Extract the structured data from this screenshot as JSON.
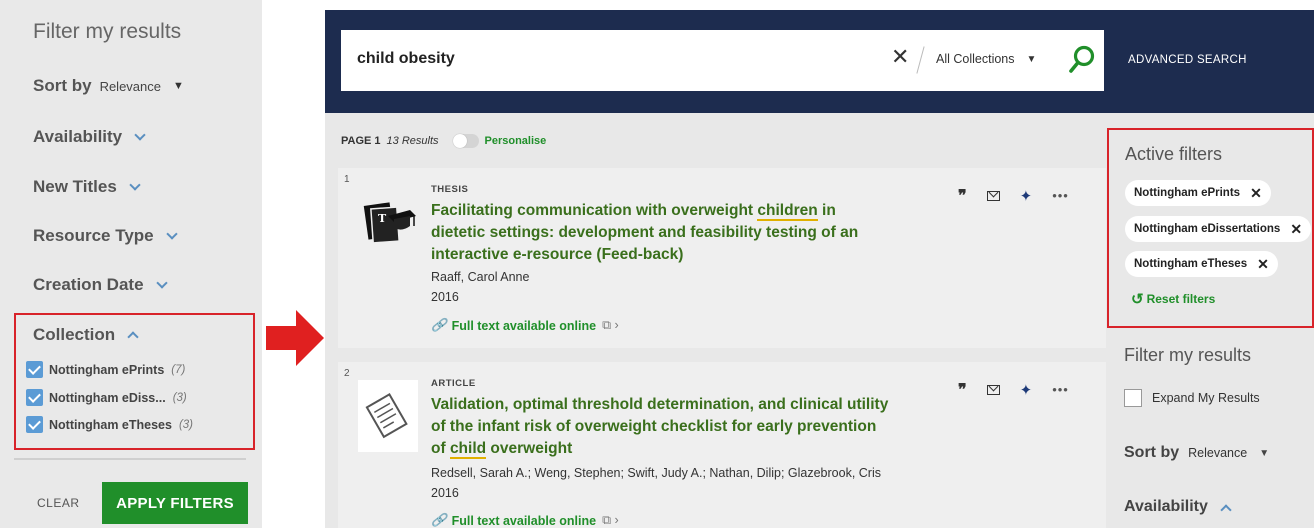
{
  "left_panel": {
    "title": "Filter my results",
    "sort_label": "Sort by",
    "sort_value": "Relevance",
    "sections": [
      "Availability",
      "New Titles",
      "Resource Type",
      "Creation Date"
    ],
    "collection": {
      "label": "Collection",
      "items": [
        {
          "label": "Nottingham ePrints",
          "count": "(7)"
        },
        {
          "label": "Nottingham eDiss...",
          "count": "(3)"
        },
        {
          "label": "Nottingham eTheses",
          "count": "(3)"
        }
      ]
    },
    "clear_label": "CLEAR",
    "apply_label": "APPLY FILTERS"
  },
  "search": {
    "query": "child obesity",
    "scope": "All Collections",
    "advanced_label": "ADVANCED SEARCH"
  },
  "results_bar": {
    "page": "PAGE 1",
    "count": "13 Results",
    "personalise": "Personalise"
  },
  "results": [
    {
      "number": "1",
      "type": "THESIS",
      "title_before": "Facilitating communication with overweight ",
      "title_highlight": "children",
      "title_after": " in dietetic settings: development and feasibility testing of an interactive e-resource (Feed-back)",
      "author": "Raaff, Carol Anne",
      "year": "2016",
      "link": "Full text available online"
    },
    {
      "number": "2",
      "type": "ARTICLE",
      "title_before": "Validation, optimal threshold determination, and clinical utility of the infant risk of overweight checklist for early prevention of ",
      "title_highlight": "child",
      "title_after": " overweight",
      "author": "Redsell, Sarah A.; Weng, Stephen; Swift, Judy A.; Nathan, Dilip; Glazebrook, Cris",
      "year": "2016",
      "link": "Full text available online"
    }
  ],
  "active_filters": {
    "title": "Active filters",
    "chips": [
      "Nottingham ePrints",
      "Nottingham eDissertations",
      "Nottingham eTheses"
    ],
    "reset_label": "Reset filters"
  },
  "right_filters": {
    "title": "Filter my results",
    "expand_label": "Expand My Results",
    "sort_label": "Sort by",
    "sort_value": "Relevance",
    "availability_label": "Availability"
  },
  "colors": {
    "accent_green": "#208f2a",
    "header_navy": "#1d2c4f",
    "highlight_red": "#d8232a",
    "checkbox_blue": "#5b9bd5"
  }
}
